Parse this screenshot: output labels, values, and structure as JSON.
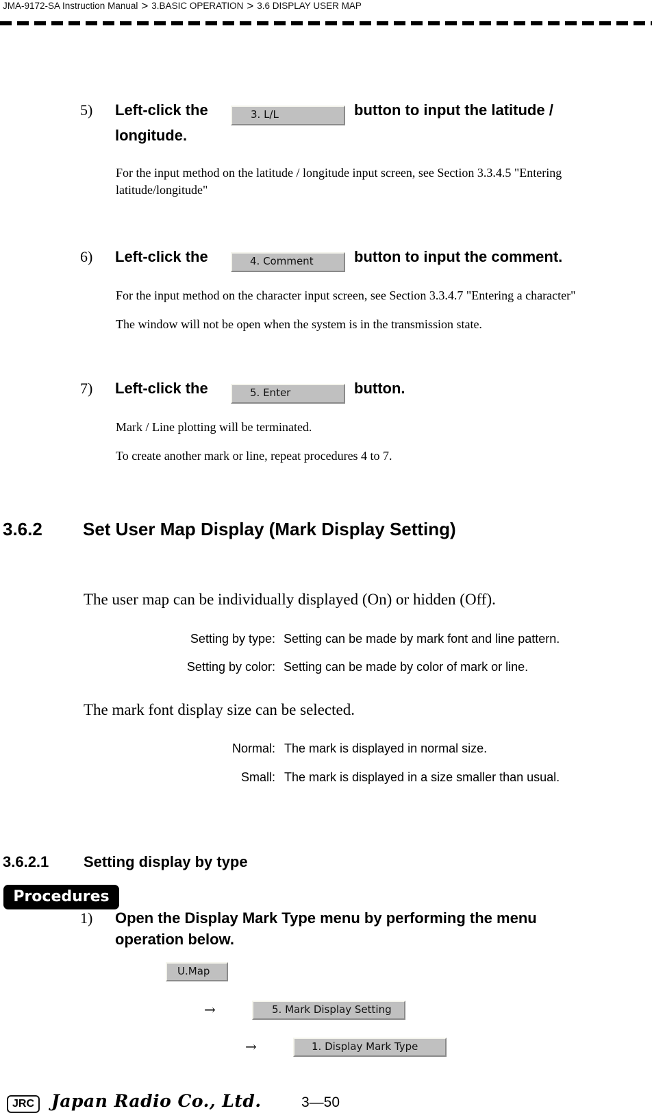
{
  "header": {
    "breadcrumb": [
      "JMA-9172-SA Instruction Manual",
      "3.BASIC OPERATION",
      "3.6  DISPLAY USER MAP"
    ],
    "separator": ">"
  },
  "steps_top": [
    {
      "number": "5)",
      "before": "Left-click the",
      "button": "3. L/L",
      "after": "button to input the latitude /",
      "continuation": "longitude.",
      "notes": [
        "For the input method on the latitude / longitude input screen, see Section 3.3.4.5 \"Entering",
        "latitude/longitude\""
      ]
    },
    {
      "number": "6)",
      "before": "Left-click the",
      "button": "4. Comment",
      "after": "button to input the comment.",
      "notes": [
        "For the input method on the character input screen, see Section 3.3.4.7 \"Entering a character\"",
        "The window will not be open when the system is in the transmission state."
      ]
    },
    {
      "number": "7)",
      "before": "Left-click the",
      "button": "5. Enter",
      "after": "button.",
      "notes": [
        "Mark / Line plotting will be terminated.",
        "To create another mark or line, repeat procedures 4 to 7."
      ]
    }
  ],
  "section": {
    "number": "3.6.2",
    "title": "Set User Map Display (Mark Display Setting)",
    "intro": "The user map can be individually displayed (On) or hidden (Off).",
    "settings": [
      {
        "term": "Setting by type:",
        "desc": "Setting can be made by mark font and line pattern."
      },
      {
        "term": "Setting by color:",
        "desc": "Setting can be made by color of mark or line."
      }
    ],
    "size_intro": "The mark font display size can be selected.",
    "sizes": [
      {
        "term": "Normal:",
        "desc": "The mark is displayed in normal size."
      },
      {
        "term": "Small:",
        "desc": "The mark is displayed in a size smaller than usual."
      }
    ]
  },
  "subsection": {
    "number": "3.6.2.1",
    "title": "Setting display by type",
    "badge": "Procedures",
    "step": {
      "number": "1)",
      "line1": "Open the Display Mark Type menu by performing the menu",
      "line2": "operation below."
    },
    "menu_path": {
      "arrow": "→",
      "buttons": [
        "U.Map",
        "5. Mark Display Setting",
        "1. Display Mark Type"
      ]
    }
  },
  "footer": {
    "logo_box": "JRC",
    "company": "Japan Radio Co., Ltd.",
    "page": "3—50"
  }
}
